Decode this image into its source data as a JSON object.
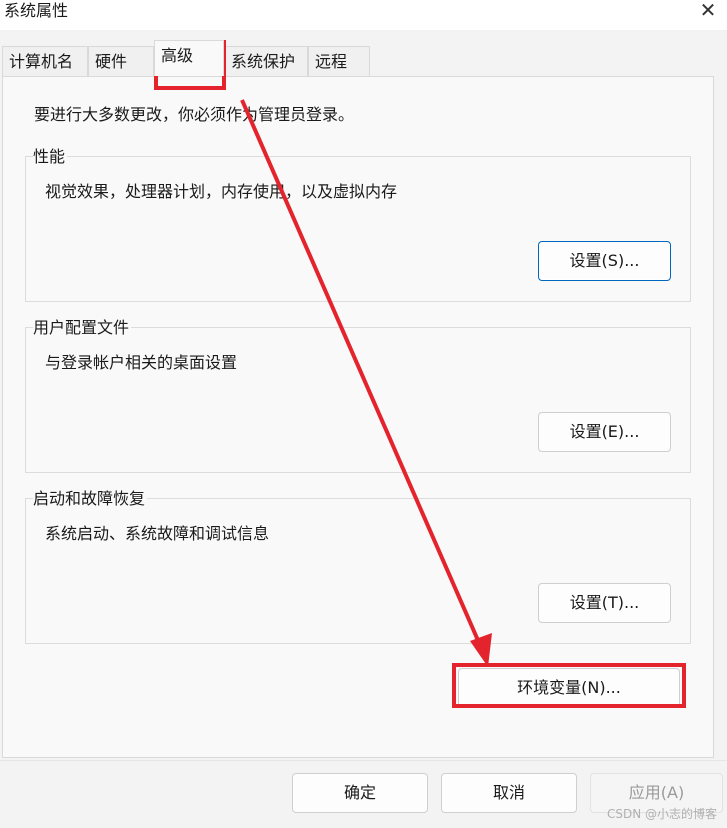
{
  "window": {
    "title": "系统属性",
    "close_glyph": "✕"
  },
  "tabs": [
    {
      "label": "计算机名"
    },
    {
      "label": "硬件"
    },
    {
      "label": "高级"
    },
    {
      "label": "系统保护"
    },
    {
      "label": "远程"
    }
  ],
  "advanced": {
    "intro": "要进行大多数更改，你必须作为管理员登录。",
    "performance": {
      "title": "性能",
      "desc": "视觉效果，处理器计划，内存使用，以及虚拟内存",
      "button": "设置(S)..."
    },
    "profile": {
      "title": "用户配置文件",
      "desc": "与登录帐户相关的桌面设置",
      "button": "设置(E)..."
    },
    "startup": {
      "title": "启动和故障恢复",
      "desc": "系统启动、系统故障和调试信息",
      "button": "设置(T)..."
    },
    "env_button": "环境变量(N)..."
  },
  "footer": {
    "ok": "确定",
    "cancel": "取消",
    "apply": "应用(A)"
  },
  "watermark": "CSDN @小志的博客",
  "colors": {
    "annotation": "#e4242c",
    "focus": "#0067c0"
  }
}
